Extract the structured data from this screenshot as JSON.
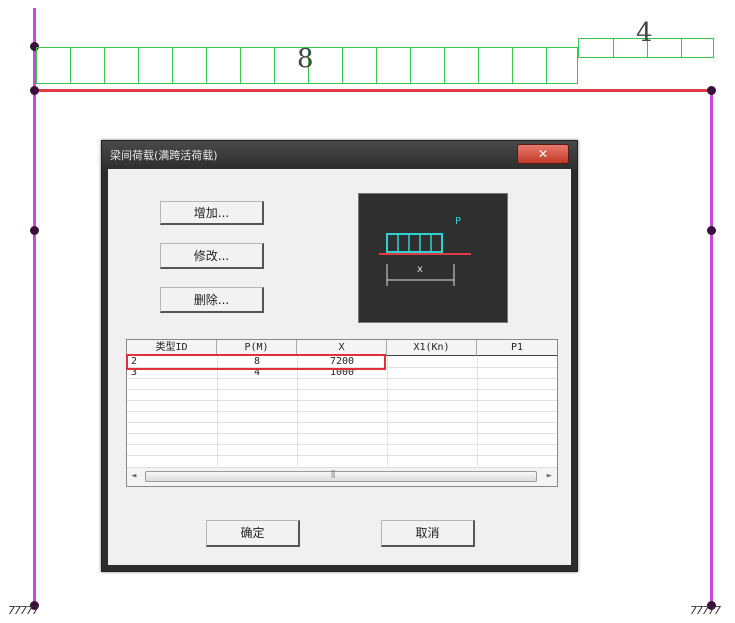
{
  "drawing": {
    "main_load_value": "8",
    "small_load_value": "4",
    "support_left": "77777",
    "support_right": "77777"
  },
  "dialog": {
    "title": "梁间荷载(满跨活荷载)",
    "close_label": "✕",
    "buttons": {
      "add": "增加...",
      "modify": "修改...",
      "delete": "删除..."
    },
    "preview": {
      "p_label": "P",
      "x_label": "x"
    },
    "table": {
      "columns": [
        "类型ID",
        "P(M)",
        "X",
        "X1(Kn)",
        "P1"
      ],
      "rows": [
        [
          "2",
          "8",
          "7200",
          "",
          ""
        ],
        [
          "3",
          "4",
          "1000",
          "",
          ""
        ]
      ],
      "scroll_thumb_glyph": "⫼"
    },
    "ok_label": "确定",
    "cancel_label": "取消"
  },
  "colors": {
    "column": "#c64bd6",
    "beam": "#e23b48",
    "load": "#35c84a",
    "highlight": "#e0303c"
  }
}
